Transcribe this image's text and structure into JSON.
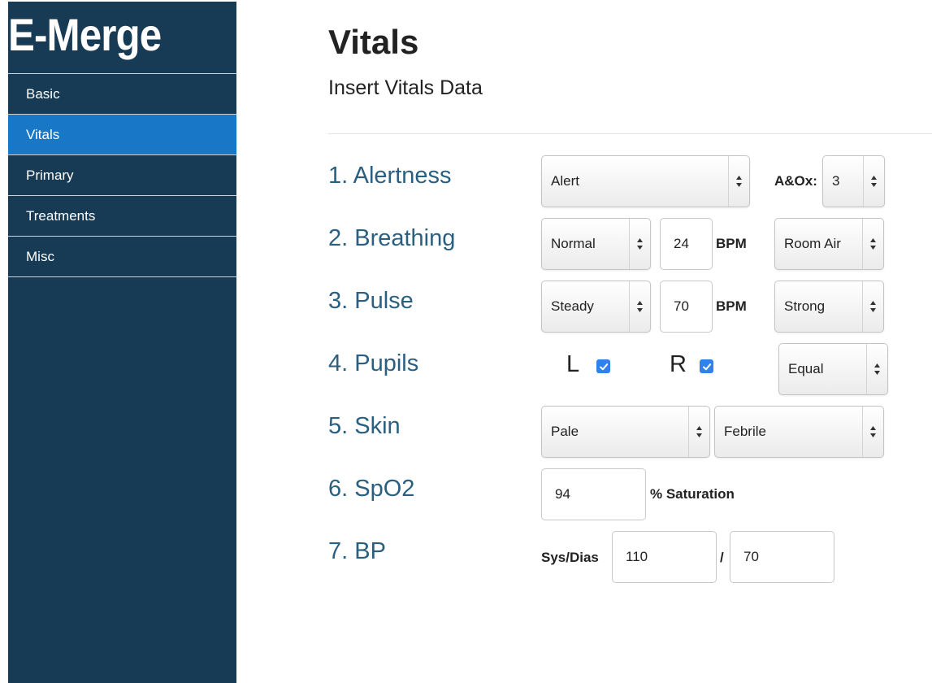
{
  "brand": {
    "name": "E-Merge"
  },
  "sidebar": {
    "items": [
      {
        "label": "Basic"
      },
      {
        "label": "Vitals"
      },
      {
        "label": "Primary"
      },
      {
        "label": "Treatments"
      },
      {
        "label": "Misc"
      }
    ],
    "active": "Vitals"
  },
  "header": {
    "title": "Vitals",
    "subtitle": "Insert Vitals Data"
  },
  "rows": {
    "alertness": {
      "label": "1. Alertness",
      "level": "Alert",
      "aox_label": "A&Ox:",
      "aox_value": "3"
    },
    "breathing": {
      "label": "2. Breathing",
      "quality": "Normal",
      "rate": "24",
      "unit": "BPM",
      "oxygen": "Room Air"
    },
    "pulse": {
      "label": "3. Pulse",
      "rhythm": "Steady",
      "rate": "70",
      "unit": "BPM",
      "strength": "Strong"
    },
    "pupils": {
      "label": "4. Pupils",
      "left_label": "L",
      "left_checked": true,
      "right_label": "R",
      "right_checked": true,
      "equality": "Equal"
    },
    "skin": {
      "label": "5. Skin",
      "color": "Pale",
      "temperature": "Febrile"
    },
    "spo2": {
      "label": "6. SpO2",
      "value": "94",
      "unit": "% Saturation"
    },
    "bp": {
      "label": "7. BP",
      "unit_label": "Sys/Dias",
      "systolic": "110",
      "separator": "/",
      "diastolic": "70"
    }
  },
  "colors": {
    "sidebar_bg": "#173b55",
    "active_item": "#1877c6",
    "label_text": "#2b5f80",
    "checkbox": "#2f82ea"
  }
}
